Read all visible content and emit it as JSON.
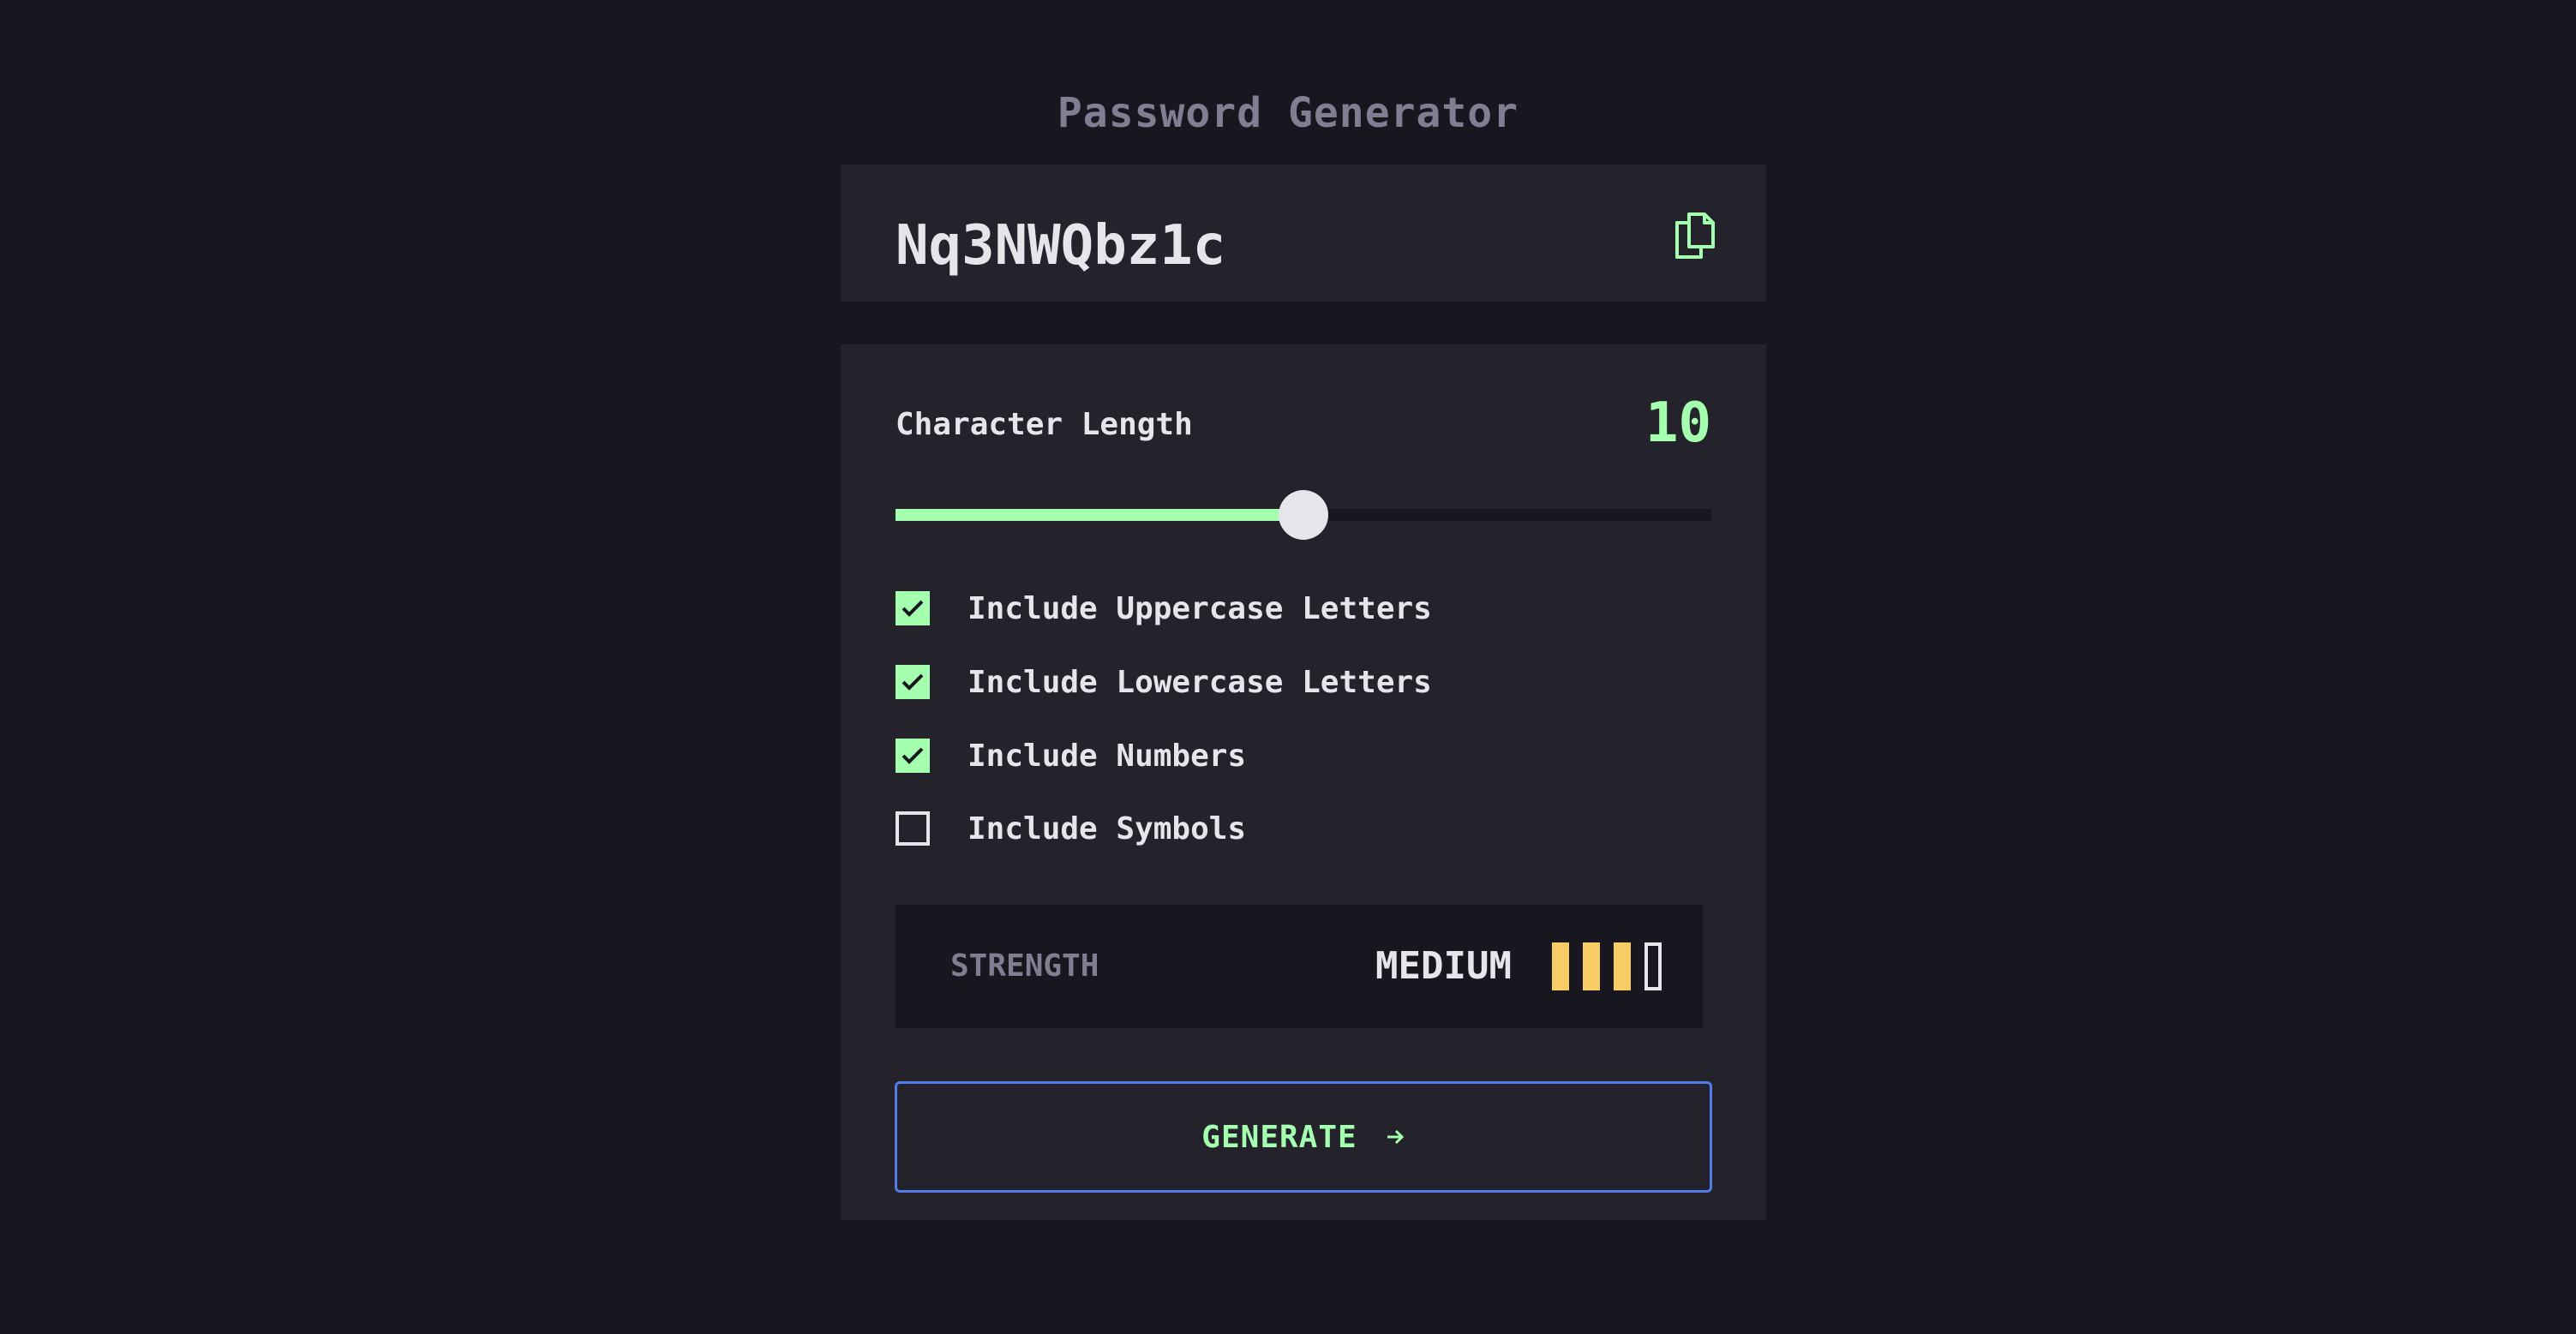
{
  "header": {
    "title": "Password Generator"
  },
  "password": {
    "value": "Nq3NWQbz1c",
    "copy_icon": "copy-icon"
  },
  "length": {
    "label": "Character Length",
    "value": "10",
    "min": 0,
    "max": 20,
    "fraction": 0.5
  },
  "options": [
    {
      "label": "Include Uppercase Letters",
      "checked": true
    },
    {
      "label": "Include Lowercase Letters",
      "checked": true
    },
    {
      "label": "Include Numbers",
      "checked": true
    },
    {
      "label": "Include Symbols",
      "checked": false
    }
  ],
  "strength": {
    "label": "STRENGTH",
    "level": "MEDIUM",
    "bars_total": 4,
    "bars_filled": 3
  },
  "generate": {
    "label": "GENERATE",
    "icon": "arrow-right-icon"
  },
  "colors": {
    "background": "#18171f",
    "card": "#24232c",
    "accent": "#a4ffaf",
    "medium": "#f8cd65",
    "text": "#e6e5ea",
    "muted": "#817d92",
    "focus_border": "#4f7ee8"
  }
}
